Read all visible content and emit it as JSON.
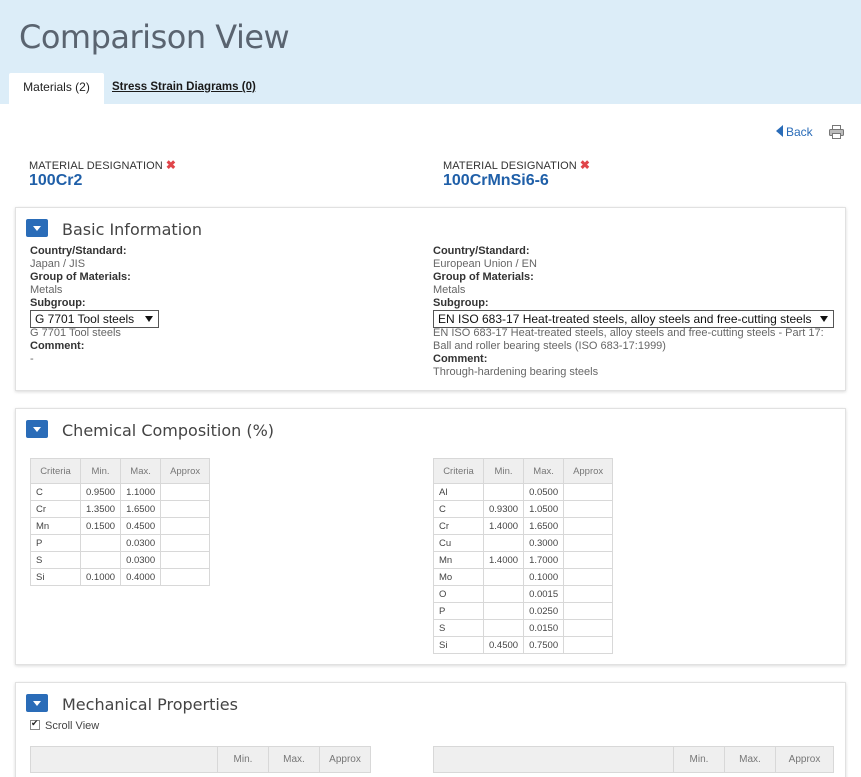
{
  "header": {
    "title": "Comparison View"
  },
  "tabs": [
    {
      "label": "Materials (2)",
      "active": true
    },
    {
      "label": "Stress Strain Diagrams (0)",
      "active": false
    }
  ],
  "toolbar": {
    "back_label": "Back",
    "print_icon": "print-icon",
    "back_icon": "back-arrow-icon"
  },
  "materials": [
    {
      "designation_label": "MATERIAL DESIGNATION",
      "remove_icon": "✖",
      "name": "100Cr2"
    },
    {
      "designation_label": "MATERIAL DESIGNATION",
      "remove_icon": "✖",
      "name": "100CrMnSi6-6"
    }
  ],
  "basic_info": {
    "title": "Basic Information",
    "labels": {
      "country": "Country/Standard:",
      "group": "Group of Materials:",
      "subgroup": "Subgroup:",
      "comment": "Comment:"
    },
    "columns": [
      {
        "country": "Japan / JIS",
        "group": "Metals",
        "subgroup_selected": "G 7701 Tool steels",
        "subgroup_text": "G 7701 Tool steels",
        "comment": "-"
      },
      {
        "country": "European Union / EN",
        "group": "Metals",
        "subgroup_selected": "EN ISO 683-17 Heat-treated steels, alloy steels and free-cutting steels",
        "subgroup_text": "EN ISO 683-17 Heat-treated steels, alloy steels and free-cutting steels - Part 17:",
        "subgroup_text2": "Ball and roller bearing steels (ISO 683-17:1999)",
        "comment": "Through-hardening bearing steels"
      }
    ]
  },
  "chemical": {
    "title": "Chemical Composition (%)",
    "headers": [
      "Criteria",
      "Min.",
      "Max.",
      "Approx"
    ],
    "tables": [
      [
        [
          "C",
          "0.9500",
          "1.1000",
          ""
        ],
        [
          "Cr",
          "1.3500",
          "1.6500",
          ""
        ],
        [
          "Mn",
          "0.1500",
          "0.4500",
          ""
        ],
        [
          "P",
          "",
          "0.0300",
          ""
        ],
        [
          "S",
          "",
          "0.0300",
          ""
        ],
        [
          "Si",
          "0.1000",
          "0.4000",
          ""
        ]
      ],
      [
        [
          "Al",
          "",
          "0.0500",
          ""
        ],
        [
          "C",
          "0.9300",
          "1.0500",
          ""
        ],
        [
          "Cr",
          "1.4000",
          "1.6500",
          ""
        ],
        [
          "Cu",
          "",
          "0.3000",
          ""
        ],
        [
          "Mn",
          "1.4000",
          "1.7000",
          ""
        ],
        [
          "Mo",
          "",
          "0.1000",
          ""
        ],
        [
          "O",
          "",
          "0.0015",
          ""
        ],
        [
          "P",
          "",
          "0.0250",
          ""
        ],
        [
          "S",
          "",
          "0.0150",
          ""
        ],
        [
          "Si",
          "0.4500",
          "0.7500",
          ""
        ]
      ]
    ]
  },
  "mechanical": {
    "title": "Mechanical Properties",
    "scroll_view_label": "Scroll View",
    "scroll_view_checked": true,
    "headers": [
      "Min.",
      "Max.",
      "Approx"
    ]
  }
}
